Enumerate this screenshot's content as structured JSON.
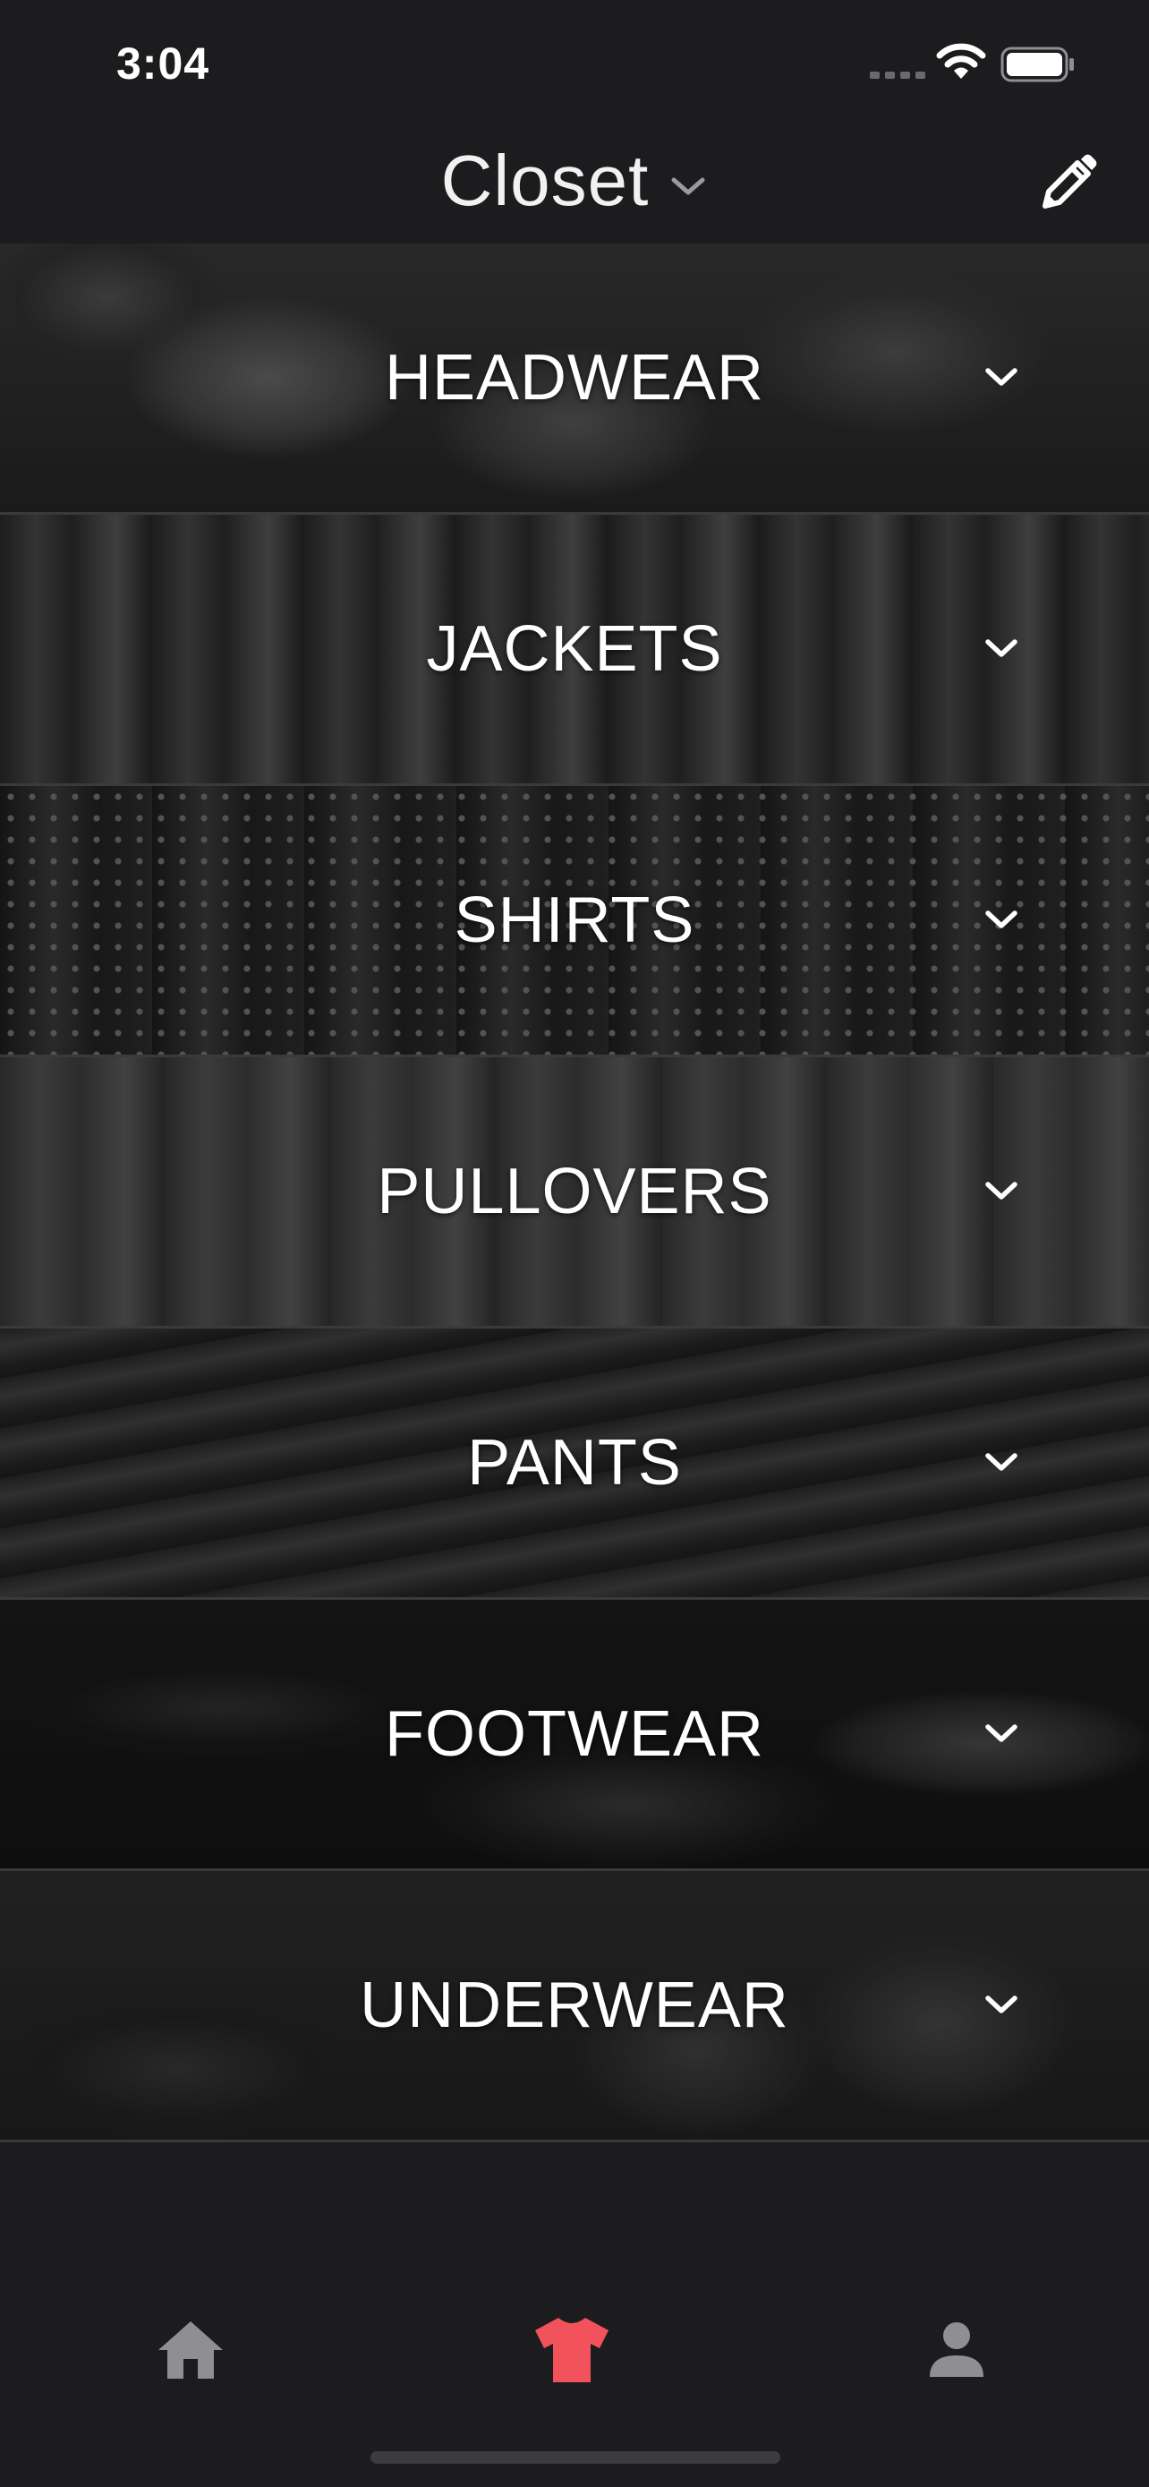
{
  "status_bar": {
    "time": "3:04"
  },
  "header": {
    "title": "Closet",
    "title_dropdown_icon": "chevron-down-icon",
    "edit_icon": "pencil-icon"
  },
  "categories": [
    {
      "label": "HEADWEAR"
    },
    {
      "label": "JACKETS"
    },
    {
      "label": "SHIRTS"
    },
    {
      "label": "PULLOVERS"
    },
    {
      "label": "PANTS"
    },
    {
      "label": "FOOTWEAR"
    },
    {
      "label": "UNDERWEAR"
    }
  ],
  "tab_bar": {
    "tabs": [
      {
        "icon": "home-icon",
        "active": false
      },
      {
        "icon": "tshirt-icon",
        "active": true
      },
      {
        "icon": "person-icon",
        "active": false
      }
    ]
  },
  "colors": {
    "background": "#1c1c1e",
    "accent": "#f2525b",
    "inactive_icon": "#8e8e93",
    "divider": "#3a3a3c"
  }
}
